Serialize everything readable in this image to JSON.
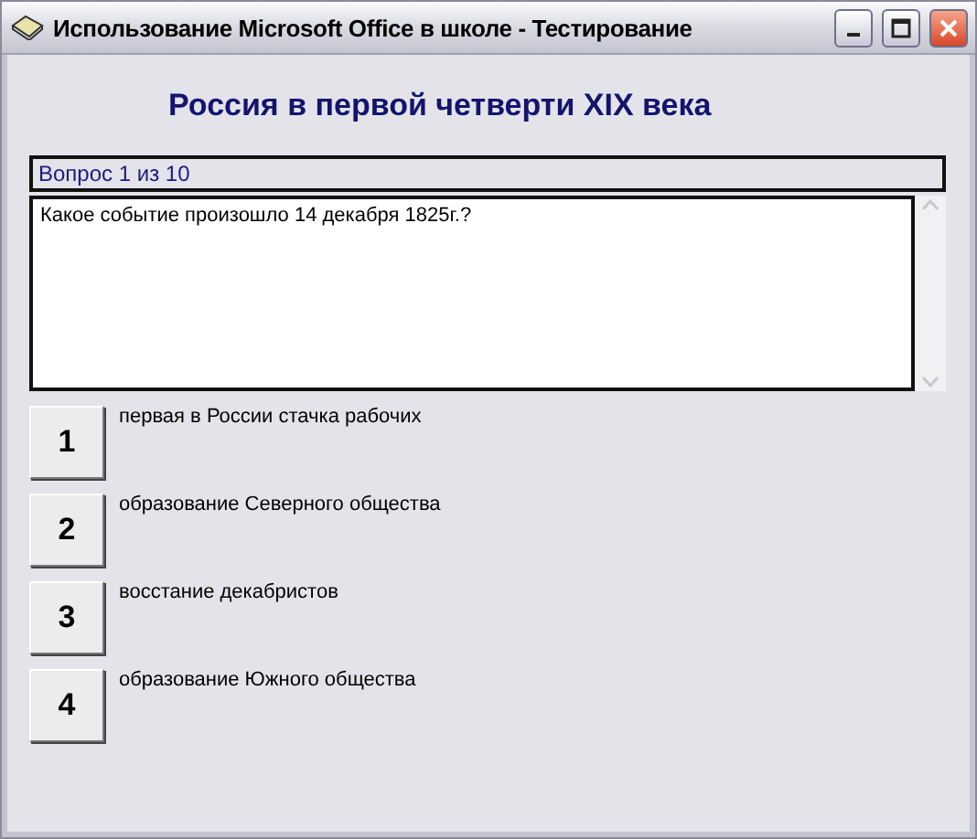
{
  "window": {
    "title": "Использование Microsoft Office в школе - Тестирование"
  },
  "heading": "Россия в первой четверти XIX века",
  "question_counter": "Вопрос 1 из 10",
  "question": {
    "text": "Какое событие произошло 14 декабря 1825г.?"
  },
  "answers": [
    {
      "number": "1",
      "text": "первая в России стачка рабочих"
    },
    {
      "number": "2",
      "text": "образование Северного общества"
    },
    {
      "number": "3",
      "text": "восстание декабристов"
    },
    {
      "number": "4",
      "text": "образование Южного общества"
    }
  ]
}
